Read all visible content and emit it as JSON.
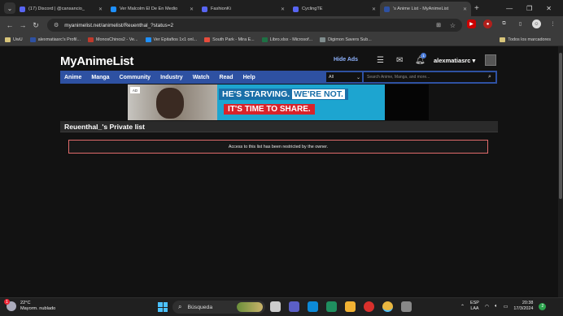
{
  "browser": {
    "tabs": [
      {
        "title": "(17) Discord | @cansancio_",
        "color": "#5865f2"
      },
      {
        "title": "Ver Malcolm El De En Medio",
        "color": "#1e90ff"
      },
      {
        "title": "FashionKi",
        "color": "#5865f2"
      },
      {
        "title": "CyclingTE",
        "color": "#5865f2"
      },
      {
        "title": "'s Anime List - MyAnimeList",
        "color": "#2e51a2",
        "active": true
      }
    ],
    "url": "myanimelist.net/animelist/Reuenthal_?status=2",
    "bookmarks": [
      {
        "label": "UwU",
        "color": "#d8c57a"
      },
      {
        "label": "alexmatiasrc's Profil...",
        "color": "#2e51a2"
      },
      {
        "label": "MonosChinos2 - Ve...",
        "color": "#c0392b"
      },
      {
        "label": "Ver Epitafios 1x1 onl...",
        "color": "#1e90ff"
      },
      {
        "label": "South Park - Mira E...",
        "color": "#e74c3c"
      },
      {
        "label": "Libro.xlsx - Microsof...",
        "color": "#1e7145"
      },
      {
        "label": "Digimon Savers Sub...",
        "color": "#7f8c8d"
      }
    ],
    "bookmarks_right": "Todos los marcadores"
  },
  "mal": {
    "logo": "MyAnimeList",
    "hide_ads": "Hide Ads",
    "notif_count": "1",
    "username": "alexmatiasrc",
    "menu": [
      "Anime",
      "Manga",
      "Community",
      "Industry",
      "Watch",
      "Read",
      "Help"
    ],
    "search_select": "All",
    "search_placeholder": "Search Anime, Manga, and more...",
    "ad_line1": "HE'S STARVING.",
    "ad_line1b": "WE'RE NOT.",
    "ad_line2": "IT'S TIME TO SHARE.",
    "ad_badge": "AD",
    "list_title": "Reuenthal_'s Private list",
    "notice": "Access to this list has been restricted by the owner."
  },
  "taskbar": {
    "weather_temp": "22°C",
    "weather_desc": "Mayorm. nublado",
    "weather_badge": "1",
    "search_label": "Búsqueda",
    "lang_top": "ESP",
    "lang_bottom": "LAA",
    "time": "20:38",
    "date": "17/3/2024",
    "notif_count": "2"
  }
}
